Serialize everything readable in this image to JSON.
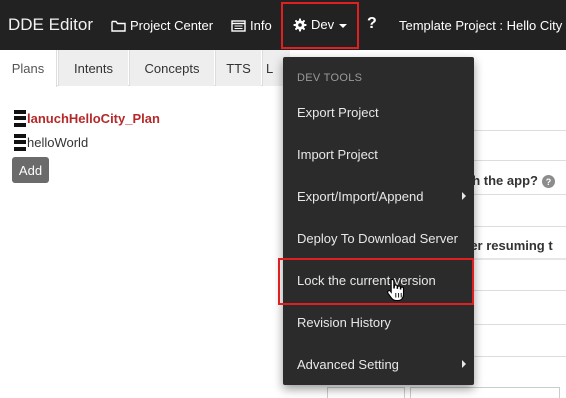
{
  "navbar": {
    "brand": "DDE Editor",
    "project_center": "Project Center",
    "info": "Info",
    "dev": "Dev",
    "help": "?",
    "template_title": "Template Project : Hello City"
  },
  "tabs": [
    {
      "label": "Plans",
      "active": true
    },
    {
      "label": "Intents",
      "active": false
    },
    {
      "label": "Concepts",
      "active": false
    },
    {
      "label": "TTS",
      "active": false
    },
    {
      "label": "L",
      "active": false
    }
  ],
  "tree": {
    "items": [
      {
        "label": "lanuchHelloCity_Plan",
        "active": true
      },
      {
        "label": "helloWorld",
        "active": false
      }
    ],
    "add_label": "Add"
  },
  "right_panel": {
    "partial_1": "ch the app?",
    "partial_2": "ter resuming t",
    "help_icon": "?"
  },
  "dropdown": {
    "header": "DEV TOOLS",
    "items": [
      {
        "label": "Export Project",
        "submenu": false
      },
      {
        "label": "Import Project",
        "submenu": false
      },
      {
        "label": "Export/Import/Append",
        "submenu": true
      },
      {
        "label": "Deploy To Download Server",
        "submenu": false
      },
      {
        "label": "Lock the current version",
        "submenu": false,
        "highlighted": true
      },
      {
        "label": "Revision History",
        "submenu": false
      },
      {
        "label": "Advanced Setting",
        "submenu": true
      }
    ]
  },
  "colors": {
    "navbar_bg": "#222222",
    "dropdown_bg": "#2b2b2b",
    "highlight_border": "#e02020",
    "active_plan": "#b5292a"
  },
  "icons": [
    "folder-icon",
    "window-icon",
    "gear-icon",
    "chevron-down-icon",
    "hand-pointer-icon"
  ]
}
